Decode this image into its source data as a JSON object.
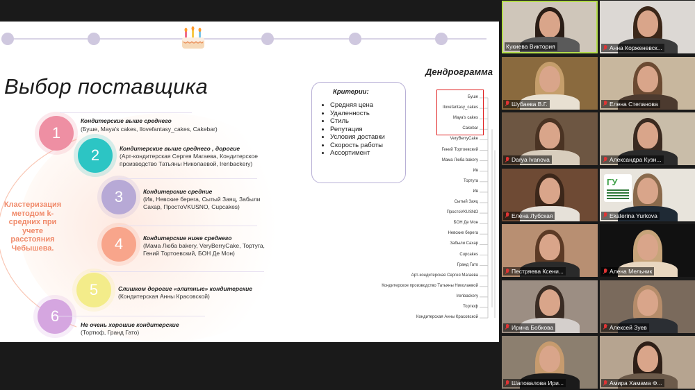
{
  "slide": {
    "title": "Выбор поставщика",
    "cluster_label": "Кластеризация методом k-средних при учете расстояния Чебышева.",
    "colors": {
      "c1": "#ee8fa3",
      "c2": "#2cc5c4",
      "c3": "#b7a9d6",
      "c4": "#f8a58b",
      "c5": "#f3ec8a",
      "c6": "#d5a6e0"
    },
    "groups": [
      {
        "num": "1",
        "title": "Кондитерские выше среднего",
        "desc": "(Буше, Maya's cakes, Ilovefantasy_cakes, Cakebar)"
      },
      {
        "num": "2",
        "title": "Кондитерские выше среднего , дорогие",
        "desc": "(Арт-кондитерская Сергея Магаева, Кондитерское производство Татьяны Николаевой, Irenbackery)"
      },
      {
        "num": "3",
        "title": "Кондитерские средние",
        "desc": "(Ив, Невские берега, Сытый Заяц, Забыли Сахар, ПростоVKUSNO, Cupcakes)"
      },
      {
        "num": "4",
        "title": "Кондитерские ниже среднего",
        "desc": "(Мама Люба bakery, VeryBerryCake, Тортуга, Гений Тортоевский, БОН Де Мон)"
      },
      {
        "num": "5",
        "title": "Слишком дорогие «элитные» кондитерские",
        "desc": "(Кондитерская Анны Красовской)"
      },
      {
        "num": "6",
        "title": "Не очень хорошие кондитерские",
        "desc": "(Тортюф, Гранд Гато)"
      }
    ],
    "criteria_title": "Критерии:",
    "criteria": [
      "Средняя цена",
      "Удаленность",
      "Стиль",
      "Репутация",
      "Условия доставки",
      "Скорость работы",
      "Ассортимент"
    ],
    "dendrogram_title": "Дендрограмма",
    "dendrogram_leaves": [
      "Буше",
      "Ilovefantasy_cakes",
      "Maya's cakes",
      "Cakebar",
      "VeryBerryCake",
      "Гений Тортоевский",
      "Мама Люба bakery",
      "Ив",
      "Тортуга",
      "Ив",
      "Сытый Заяц",
      "ПростоVKUSNO",
      "БОН Де Мон",
      "Невские берега",
      "Забыли Сахар",
      "Cupcakes",
      "Гранд Гато",
      "Арт-кондитерская Сергея Магаева",
      "Кондитерское производство Татьяны Николаевой",
      "Irenbackery",
      "Тортюф",
      "Кондитерская Анны Красовской"
    ]
  },
  "participants": [
    {
      "name": "Кукиева Виктория",
      "active": true,
      "muted": false,
      "bg": "#cfc6ba",
      "hair": "#2a1d16",
      "shirt": "#5a5a5a"
    },
    {
      "name": "Анна Корженевск...",
      "active": false,
      "muted": true,
      "bg": "#dcd8d4",
      "hair": "#3b2719",
      "shirt": "#3b3b3b"
    },
    {
      "name": "Шубаева В.Г.",
      "active": false,
      "muted": true,
      "bg": "#8a6a3e",
      "hair": "#c59e6b",
      "shirt": "#e8e0d2"
    },
    {
      "name": "Елена Степанова",
      "active": false,
      "muted": true,
      "bg": "#c8b79e",
      "hair": "#6b4a32",
      "shirt": "#4c3a2f"
    },
    {
      "name": "Darya Ivanova",
      "active": false,
      "muted": true,
      "bg": "#6d5642",
      "hair": "#4a3323",
      "shirt": "#d8cdbd"
    },
    {
      "name": "Александра Кузн...",
      "active": false,
      "muted": true,
      "bg": "#c9bda9",
      "hair": "#3a2a20",
      "shirt": "#2b2b2b"
    },
    {
      "name": "Елена Лубская",
      "active": false,
      "muted": true,
      "bg": "#6e4a34",
      "hair": "#3c271a",
      "shirt": "#e6e1d9"
    },
    {
      "name": "Ekaterina Yurkova",
      "active": false,
      "muted": true,
      "bg": "#e8e4dc",
      "hair": "#8a6a4c",
      "shirt": "#1f2a35",
      "logo": "ГУ"
    },
    {
      "name": "Пестряева Ксени...",
      "active": false,
      "muted": true,
      "bg": "#b88f72",
      "hair": "#5c3a25",
      "shirt": "#2a2a2a"
    },
    {
      "name": "Алена Мельник",
      "active": false,
      "muted": true,
      "bg": "#111111",
      "hair": "#c7a47a",
      "shirt": "#e9d7c0"
    },
    {
      "name": "Ирина Бобкова",
      "active": false,
      "muted": true,
      "bg": "#9c8e83",
      "hair": "#3a2c24",
      "shirt": "#d4cfcc"
    },
    {
      "name": "Алексей Зуев",
      "active": false,
      "muted": true,
      "bg": "#7a6a5c",
      "hair": "#b58c6a",
      "shirt": "#2b2e33"
    },
    {
      "name": "Шаповалова Ири...",
      "active": false,
      "muted": true,
      "bg": "#8c7f6f",
      "hair": "#c69b6e",
      "shirt": "#1b1b1b"
    },
    {
      "name": "Амира Хамама Ф...",
      "active": false,
      "muted": true,
      "bg": "#b6a490",
      "hair": "#2e1f17",
      "shirt": "#6c5a4a"
    }
  ]
}
